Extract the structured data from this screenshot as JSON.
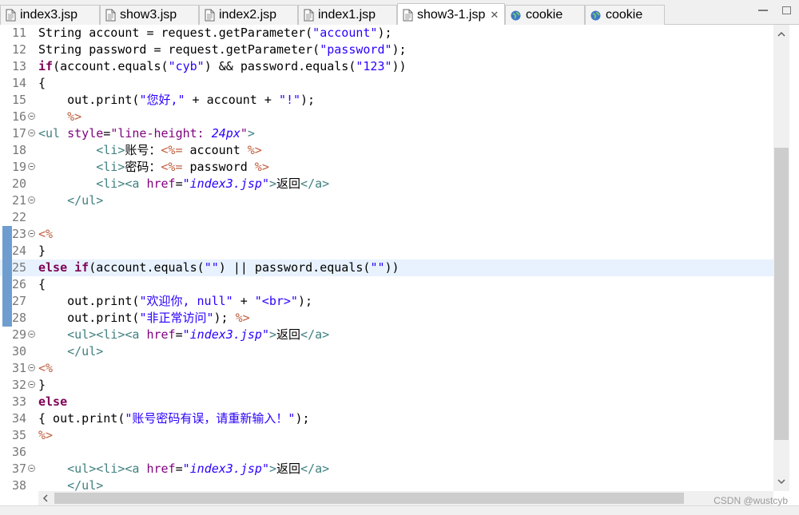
{
  "tabs": [
    {
      "label": "index3.jsp",
      "icon": "jsp-file-icon",
      "active": false
    },
    {
      "label": "show3.jsp",
      "icon": "jsp-file-icon",
      "active": false
    },
    {
      "label": "index2.jsp",
      "icon": "jsp-file-icon",
      "active": false
    },
    {
      "label": "index1.jsp",
      "icon": "jsp-file-icon",
      "active": false
    },
    {
      "label": "show3-1.jsp",
      "icon": "jsp-file-icon",
      "active": true,
      "close": "✕"
    },
    {
      "label": "cookie",
      "icon": "globe-icon",
      "active": false
    },
    {
      "label": "cookie",
      "icon": "globe-icon",
      "active": false
    }
  ],
  "editor": {
    "lines": [
      {
        "n": "11"
      },
      {
        "n": "12"
      },
      {
        "n": "13"
      },
      {
        "n": "14"
      },
      {
        "n": "15"
      },
      {
        "n": "16"
      },
      {
        "n": "17"
      },
      {
        "n": "18"
      },
      {
        "n": "19"
      },
      {
        "n": "20"
      },
      {
        "n": "21"
      },
      {
        "n": "22"
      },
      {
        "n": "23"
      },
      {
        "n": "24"
      },
      {
        "n": "25"
      },
      {
        "n": "26"
      },
      {
        "n": "27"
      },
      {
        "n": "28"
      },
      {
        "n": "29"
      },
      {
        "n": "30"
      },
      {
        "n": "31"
      },
      {
        "n": "32"
      },
      {
        "n": "33"
      },
      {
        "n": "34"
      },
      {
        "n": "35"
      },
      {
        "n": "36"
      },
      {
        "n": "37"
      },
      {
        "n": "38"
      }
    ],
    "tokens": {
      "l11": [
        "String account = request.getParameter(",
        "\"account\"",
        ");"
      ],
      "l12": [
        "String password = request.getParameter(",
        "\"password\"",
        ");"
      ],
      "l13": [
        "if",
        "(account.equals(",
        "\"cyb\"",
        ") && password.equals(",
        "\"123\"",
        "))"
      ],
      "l14": [
        "{"
      ],
      "l15": [
        "    out.print(",
        "\"您好,\"",
        " + account + ",
        "\"!\"",
        ");"
      ],
      "l16": [
        "    ",
        "%>"
      ],
      "l17": [
        "<ul",
        " ",
        "style",
        "=",
        "\"line-height: ",
        "24px",
        "\"",
        ">"
      ],
      "l18": [
        "        ",
        "<li>",
        "账号：",
        "<%=",
        " account ",
        "%>"
      ],
      "l19": [
        "        ",
        "<li>",
        "密码：",
        "<%=",
        " password ",
        "%>"
      ],
      "l20": [
        "        ",
        "<li><a",
        " ",
        "href",
        "=",
        "\"index3.jsp\"",
        ">",
        "返回",
        "</a>"
      ],
      "l21": [
        "    ",
        "</ul>"
      ],
      "l22": [
        ""
      ],
      "l23": [
        "<%"
      ],
      "l24": [
        "}"
      ],
      "l25": [
        "else",
        " ",
        "if",
        "(account.equals(",
        "\"\"",
        ") || password.equals(",
        "\"\"",
        "))"
      ],
      "l26": [
        "{"
      ],
      "l27": [
        "    out.print(",
        "\"欢迎你, null\"",
        " + ",
        "\"<br>\"",
        ");"
      ],
      "l28": [
        "    out.print(",
        "\"非正常访问\"",
        "); ",
        "%>"
      ],
      "l29": [
        "    ",
        "<ul><li><a",
        " ",
        "href",
        "=",
        "\"index3.jsp\"",
        ">",
        "返回",
        "</a>"
      ],
      "l30": [
        "    ",
        "</ul>"
      ],
      "l31": [
        "<%"
      ],
      "l32": [
        "}"
      ],
      "l33": [
        "else"
      ],
      "l34": [
        "{ out.print(",
        "\"账号密码有误，请重新输入！\"",
        ");"
      ],
      "l35": [
        "%>"
      ],
      "l36": [
        ""
      ],
      "l37": [
        "    ",
        "<ul><li><a",
        " ",
        "href",
        "=",
        "\"index3.jsp\"",
        ">",
        "返回",
        "</a>"
      ],
      "l38": [
        "    ",
        "</ul>"
      ]
    }
  },
  "colors": {
    "keyword": "#7f0055",
    "string": "#2a00ff",
    "jsp_delimiter": "#bf5f3f",
    "html_tag": "#3f7f7f",
    "attribute": "#7f007f",
    "current_line": "#e8f2fe"
  },
  "watermark": "CSDN @wustcyb"
}
